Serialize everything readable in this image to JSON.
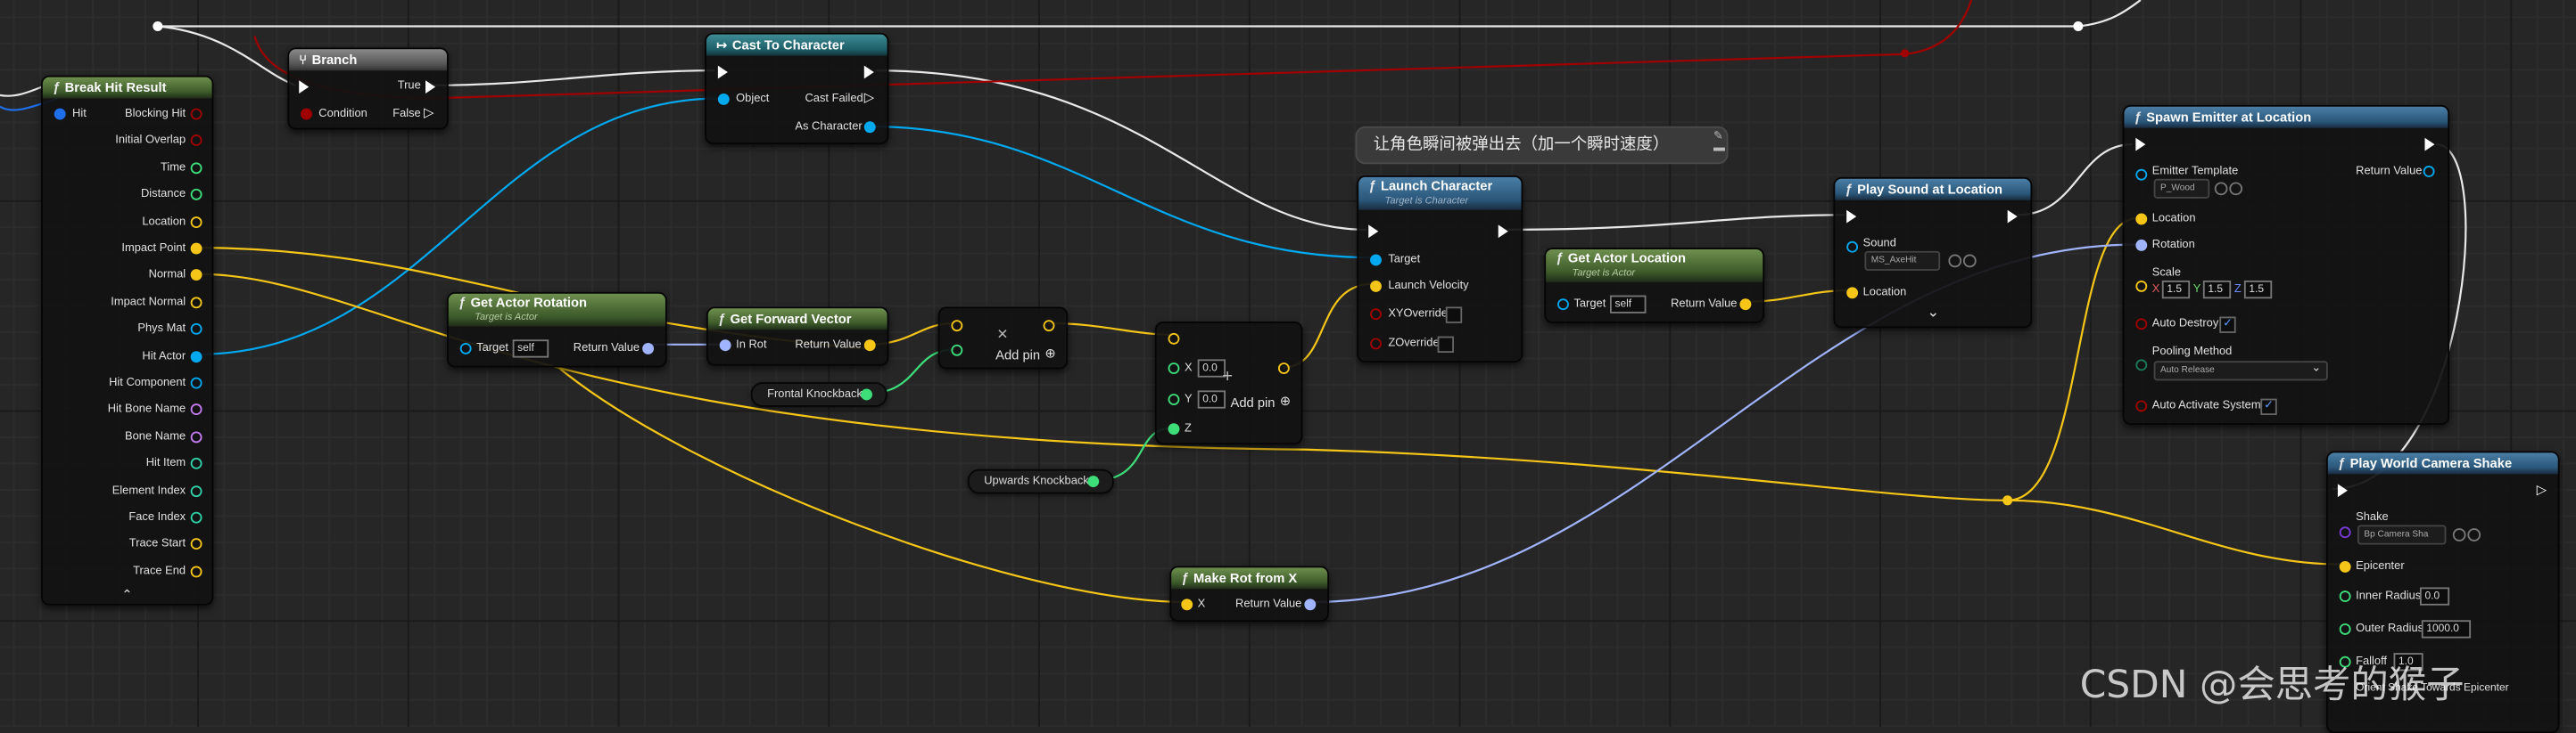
{
  "comment": "让角色瞬间被弹出去（加一个瞬时速度）",
  "nodes": {
    "break_hit": {
      "title": "Break Hit Result",
      "in_pin": "Hit",
      "outputs": [
        "Blocking Hit",
        "Initial Overlap",
        "Time",
        "Distance",
        "Location",
        "Impact Point",
        "Normal",
        "Impact Normal",
        "Phys Mat",
        "Hit Actor",
        "Hit Component",
        "Hit Bone Name",
        "Bone Name",
        "Hit Item",
        "Element Index",
        "Face Index",
        "Trace Start",
        "Trace End"
      ],
      "collapse": "⌃"
    },
    "branch": {
      "title": "Branch",
      "condition": "Condition",
      "true": "True",
      "false": "False"
    },
    "cast": {
      "title": "Cast To Character",
      "object": "Object",
      "cast_failed": "Cast Failed",
      "as_character": "As Character"
    },
    "launch": {
      "title": "Launch Character",
      "subtitle": "Target is Character",
      "target": "Target",
      "launch_velocity": "Launch Velocity",
      "xy_override": "XYOverride",
      "z_override": "ZOverride"
    },
    "get_actor_location": {
      "title": "Get Actor Location",
      "subtitle": "Target is Actor",
      "target": "Target",
      "self": "self",
      "return_value": "Return Value"
    },
    "play_sound": {
      "title": "Play Sound at Location",
      "sound": "Sound",
      "sound_value": "MS_AxeHit",
      "location": "Location",
      "expand": "⌄"
    },
    "spawn_emitter": {
      "title": "Spawn Emitter at Location",
      "emitter_template": "Emitter Template",
      "emitter_value": "P_Wood",
      "return_value": "Return Value",
      "location": "Location",
      "rotation": "Rotation",
      "scale": "Scale",
      "scale_x_label": "X",
      "scale_y_label": "Y",
      "scale_z_label": "Z",
      "scale_x": "1.5",
      "scale_y": "1.5",
      "scale_z": "1.5",
      "auto_destroy": "Auto Destroy",
      "pooling_method": "Pooling Method",
      "pooling_value": "Auto Release",
      "auto_activate": "Auto Activate System"
    },
    "get_actor_rotation": {
      "title": "Get Actor Rotation",
      "subtitle": "Target is Actor",
      "target": "Target",
      "self": "self",
      "return_value": "Return Value"
    },
    "get_forward_vector": {
      "title": "Get Forward Vector",
      "in_rot": "In Rot",
      "return_value": "Return Value"
    },
    "multiply": {
      "symbol": "×",
      "add_pin": "Add pin"
    },
    "make_vector": {
      "symbol": "+",
      "x_label": "X",
      "y_label": "Y",
      "z_label": "Z",
      "x": "0.0",
      "y": "0.0",
      "add_pin": "Add pin"
    },
    "make_rot": {
      "title": "Make Rot from X",
      "x": "X",
      "return_value": "Return Value"
    },
    "camera_shake": {
      "title": "Play World Camera Shake",
      "shake": "Shake",
      "shake_value": "Bp Camera Sha",
      "epicenter": "Epicenter",
      "inner_radius": "Inner Radius",
      "inner_value": "0.0",
      "outer_radius": "Outer Radius",
      "outer_value": "1000.0",
      "falloff": "Falloff",
      "falloff_value": "1.0",
      "orient": "Orient Shake Towards Epicenter"
    }
  },
  "variables": {
    "frontal": "Frontal Knockback",
    "upwards": "Upwards Knockback"
  },
  "watermark": "CSDN @会思考的猴子",
  "colors": {
    "exec": "#ffffff",
    "object": "#00a8f0",
    "vector": "#f5c518",
    "rotator": "#a0b4ff",
    "float": "#3dde7a",
    "bool": "#a00000",
    "name": "#c47bf1",
    "int": "#2fd1a6",
    "struct": "#1f6feb"
  }
}
